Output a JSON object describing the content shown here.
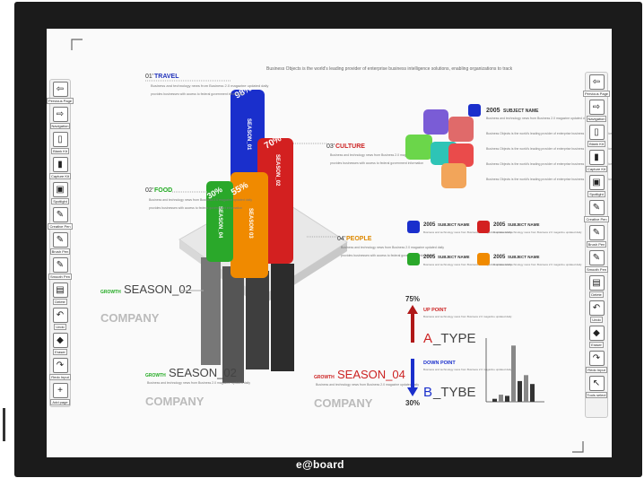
{
  "brand": "e@board",
  "sidebar_left": [
    {
      "icon": "arrow-left-icon",
      "glyph": "⇦",
      "label": "Pervious Page"
    },
    {
      "icon": "arrow-right-icon",
      "glyph": "⇨",
      "label": "Navigation"
    },
    {
      "icon": "page-icon",
      "glyph": "▯",
      "label": "Blank Kit"
    },
    {
      "icon": "page-dark-icon",
      "glyph": "▮",
      "label": "Capture Kit"
    },
    {
      "icon": "screen-icon",
      "glyph": "▣",
      "label": "Spotlight"
    },
    {
      "icon": "pen-icon",
      "glyph": "✎",
      "label": "Creative Pen"
    },
    {
      "icon": "pen-icon",
      "glyph": "✎",
      "label": "Brush Pen"
    },
    {
      "icon": "pen-icon",
      "glyph": "✎",
      "label": "Smooth Pen"
    },
    {
      "icon": "save-icon",
      "glyph": "▤",
      "label": "Delete"
    },
    {
      "icon": "undo-icon",
      "glyph": "↶",
      "label": "Undo"
    },
    {
      "icon": "eraser-icon",
      "glyph": "◆",
      "label": "Eraser"
    },
    {
      "icon": "redo-icon",
      "glyph": "↷",
      "label": "Redo Input"
    },
    {
      "icon": "add-icon",
      "glyph": "+",
      "label": "Add page"
    }
  ],
  "sidebar_right": [
    {
      "icon": "arrow-left-icon",
      "glyph": "⇦",
      "label": "Pervious Page"
    },
    {
      "icon": "arrow-right-icon",
      "glyph": "⇨",
      "label": "Navigation"
    },
    {
      "icon": "page-icon",
      "glyph": "▯",
      "label": "Blank Kit"
    },
    {
      "icon": "page-dark-icon",
      "glyph": "▮",
      "label": "Capture Kit"
    },
    {
      "icon": "screen-icon",
      "glyph": "▣",
      "label": "Spotlight"
    },
    {
      "icon": "pen-icon",
      "glyph": "✎",
      "label": "Creative Pen"
    },
    {
      "icon": "pen-icon",
      "glyph": "✎",
      "label": "Brush Pen"
    },
    {
      "icon": "pen-icon",
      "glyph": "✎",
      "label": "Smooth Pen"
    },
    {
      "icon": "save-icon",
      "glyph": "▤",
      "label": "Delete"
    },
    {
      "icon": "undo-icon",
      "glyph": "↶",
      "label": "Undo"
    },
    {
      "icon": "eraser-icon",
      "glyph": "◆",
      "label": "Eraser"
    },
    {
      "icon": "redo-icon",
      "glyph": "↷",
      "label": "Redo Input"
    },
    {
      "icon": "pointer-icon",
      "glyph": "↖",
      "label": "Tools select"
    }
  ],
  "slide": {
    "travel": {
      "num": "01'",
      "name": "TRAVEL",
      "color": "#2233bb"
    },
    "culture": {
      "num": "03'",
      "name": "CULTURE",
      "color": "#cc2222"
    },
    "food": {
      "num": "02'",
      "name": "FOOD",
      "color": "#22aa22"
    },
    "people": {
      "num": "04'",
      "name": "PEOPLE",
      "color": "#dd8800"
    },
    "intro": "Business Objects is the world's leading provider of enterprise business intelligence solutions, enabling organizations to track",
    "bullet1": "Business and technology news from Business 2.0 magazine updated daily",
    "bullet2": "provides businesses with access to federal government information",
    "cols": [
      {
        "pct": "98%",
        "label": "SEASON_01",
        "color": "#1a2fcc"
      },
      {
        "pct": "70%",
        "label": "SEASON_02",
        "color": "#d32020"
      },
      {
        "pct": "55%",
        "label": "SEASON 03",
        "color": "#f08a00"
      },
      {
        "pct": "30%",
        "label": "SEASON_04",
        "color": "#2aa82a"
      }
    ],
    "growth": "GROWTH",
    "season_02": "SEASON_02",
    "season_04": "SEASON_04",
    "company": "COMPANY",
    "subject_year": "2005",
    "subject": "SUBJECT NAME",
    "small_text": "Business and technology news from Business 2.0 magazine updated daily",
    "pct_top": "75%",
    "pct_bottom": "30%",
    "up_point": "UP POINT",
    "down_point": "DOWN POINT",
    "a_letter": "A",
    "a_type": "_TYPE",
    "b_letter": "B",
    "b_type": "_TYBE",
    "bars": [
      0.05,
      0.12,
      0.1,
      0.95,
      0.35,
      0.45,
      0.3
    ]
  }
}
